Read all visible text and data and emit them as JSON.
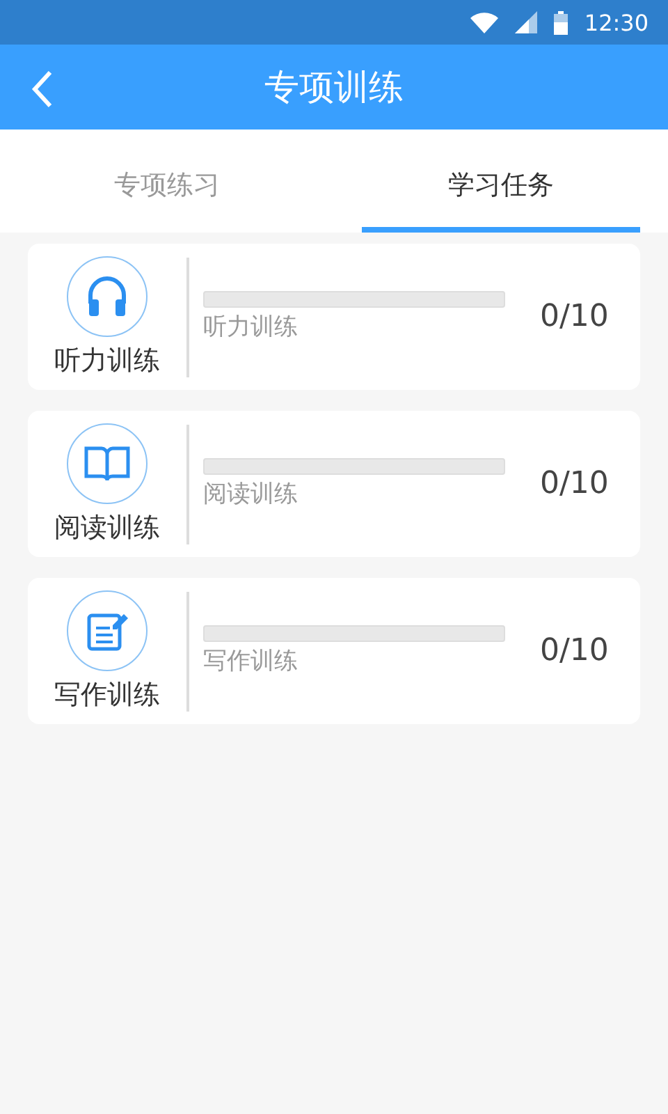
{
  "status_bar": {
    "time": "12:30"
  },
  "header": {
    "title": "专项训练"
  },
  "tabs": [
    {
      "label": "专项练习",
      "selected": false
    },
    {
      "label": "学习任务",
      "selected": true
    }
  ],
  "tasks": [
    {
      "kind": "listening",
      "name": "听力训练",
      "caption": "听力训练",
      "level": 0,
      "count": "0/10"
    },
    {
      "kind": "reading",
      "name": "阅读训练",
      "caption": "阅读训练",
      "level": 0,
      "count": "0/10"
    },
    {
      "kind": "writing",
      "name": "写作训练",
      "caption": "写作训练",
      "level": 0,
      "count": "0/10"
    }
  ]
}
